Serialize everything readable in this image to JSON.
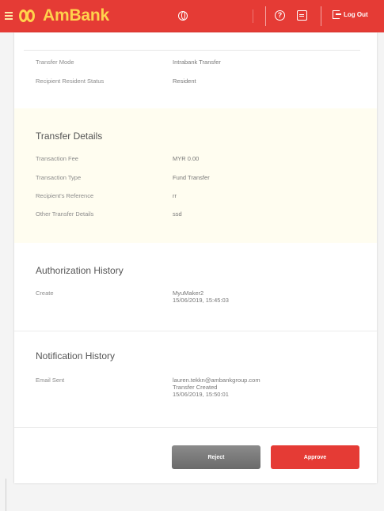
{
  "header": {
    "brand": "AmBank",
    "logout_label": "Log Out",
    "help_icon_text": "?"
  },
  "transfer_info": [
    {
      "label": "Transfer Mode",
      "value": "Intrabank Transfer"
    },
    {
      "label": "Recipient Resident Status",
      "value": "Resident"
    }
  ],
  "transfer_details": {
    "title": "Transfer Details",
    "rows": [
      {
        "label": "Transaction Fee",
        "value": "MYR 0.00"
      },
      {
        "label": "Transaction Type",
        "value": "Fund Transfer"
      },
      {
        "label": "Recipient's Reference",
        "value": "rr"
      },
      {
        "label": "Other Transfer Details",
        "value": "ssd"
      }
    ]
  },
  "authorization_history": {
    "title": "Authorization History",
    "label": "Create",
    "value_line1": "MyuMaker2",
    "value_line2": "15/06/2019, 15:45:03"
  },
  "notification_history": {
    "title": "Notification History",
    "label": "Email Sent",
    "value_line1": "lauren.tekkn@ambankgroup.com",
    "value_line2": "Transfer Created",
    "value_line3": "15/06/2019, 15:50:01"
  },
  "actions": {
    "reject_label": "Reject",
    "approve_label": "Approve"
  },
  "colors": {
    "brand_red": "#e53b35",
    "brand_yellow": "#ffd24c",
    "details_band": "#fffdf0"
  }
}
